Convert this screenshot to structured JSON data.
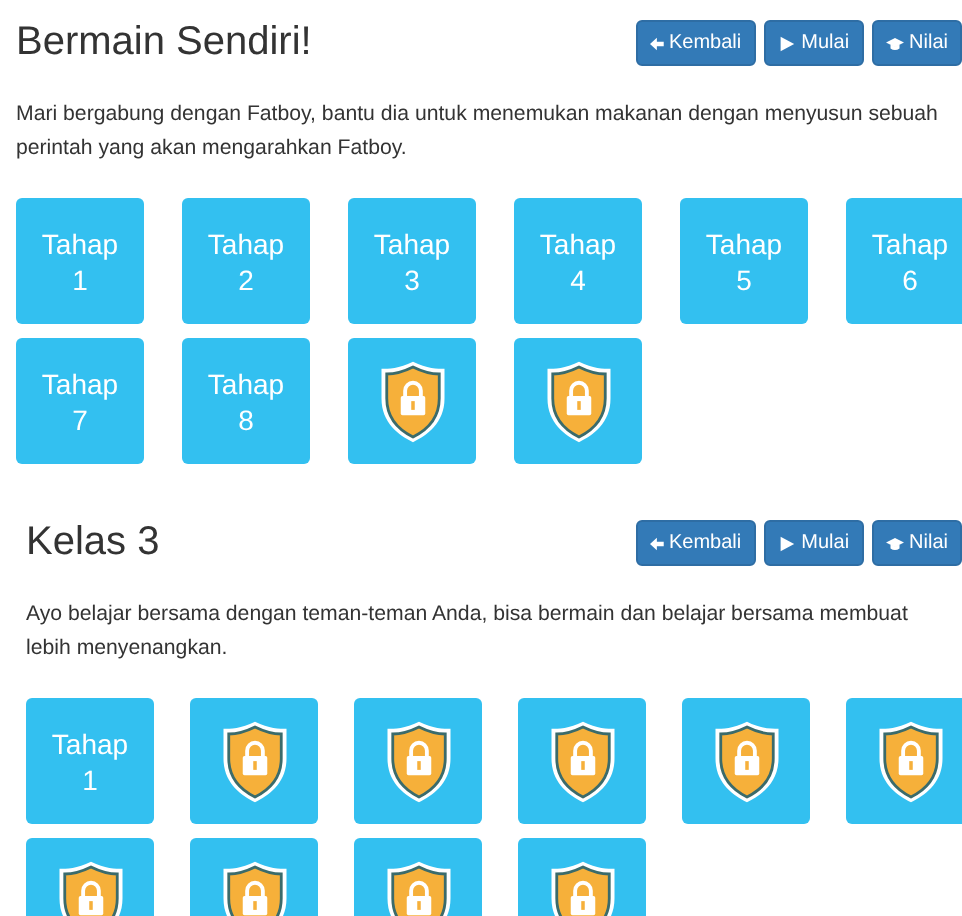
{
  "sections": [
    {
      "title": "Bermain Sendiri!",
      "buttons": [
        {
          "label": "Kembali",
          "kind": "back"
        },
        {
          "label": "Mulai",
          "kind": "play"
        },
        {
          "label": "Nilai",
          "kind": "grade"
        }
      ],
      "description": "Mari bergabung dengan Fatboy, bantu dia untuk menemukan makanan dengan menyusun sebuah perintah yang akan mengarahkan Fatboy.",
      "stages": [
        {
          "kind": "open",
          "label": "Tahap 1"
        },
        {
          "kind": "open",
          "label": "Tahap 2"
        },
        {
          "kind": "open",
          "label": "Tahap 3"
        },
        {
          "kind": "open",
          "label": "Tahap 4"
        },
        {
          "kind": "open",
          "label": "Tahap 5"
        },
        {
          "kind": "open",
          "label": "Tahap 6"
        },
        {
          "kind": "open",
          "label": "Tahap 7"
        },
        {
          "kind": "open",
          "label": "Tahap 8"
        },
        {
          "kind": "locked"
        },
        {
          "kind": "locked"
        }
      ]
    },
    {
      "title": "Kelas 3",
      "buttons": [
        {
          "label": "Kembali",
          "kind": "back"
        },
        {
          "label": "Mulai",
          "kind": "play"
        },
        {
          "label": "Nilai",
          "kind": "grade"
        }
      ],
      "description": "Ayo belajar bersama dengan teman-teman Anda, bisa bermain dan belajar bersama membuat lebih menyenangkan.",
      "stages": [
        {
          "kind": "open",
          "label": "Tahap 1"
        },
        {
          "kind": "locked"
        },
        {
          "kind": "locked"
        },
        {
          "kind": "locked"
        },
        {
          "kind": "locked"
        },
        {
          "kind": "locked"
        },
        {
          "kind": "locked"
        },
        {
          "kind": "locked"
        },
        {
          "kind": "locked"
        },
        {
          "kind": "locked"
        }
      ]
    }
  ]
}
